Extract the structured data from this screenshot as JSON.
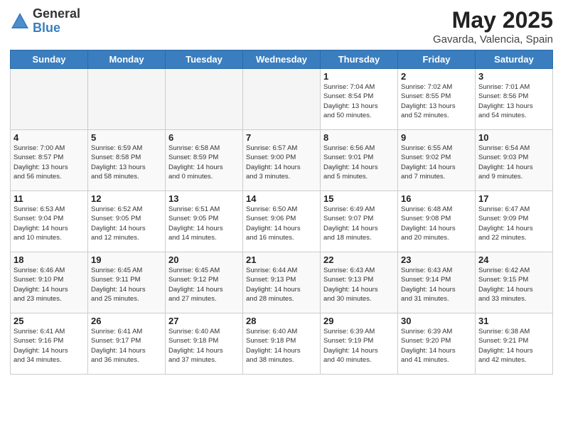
{
  "logo": {
    "general": "General",
    "blue": "Blue"
  },
  "header": {
    "title": "May 2025",
    "subtitle": "Gavarda, Valencia, Spain"
  },
  "weekdays": [
    "Sunday",
    "Monday",
    "Tuesday",
    "Wednesday",
    "Thursday",
    "Friday",
    "Saturday"
  ],
  "weeks": [
    [
      {
        "day": "",
        "info": ""
      },
      {
        "day": "",
        "info": ""
      },
      {
        "day": "",
        "info": ""
      },
      {
        "day": "",
        "info": ""
      },
      {
        "day": "1",
        "info": "Sunrise: 7:04 AM\nSunset: 8:54 PM\nDaylight: 13 hours\nand 50 minutes."
      },
      {
        "day": "2",
        "info": "Sunrise: 7:02 AM\nSunset: 8:55 PM\nDaylight: 13 hours\nand 52 minutes."
      },
      {
        "day": "3",
        "info": "Sunrise: 7:01 AM\nSunset: 8:56 PM\nDaylight: 13 hours\nand 54 minutes."
      }
    ],
    [
      {
        "day": "4",
        "info": "Sunrise: 7:00 AM\nSunset: 8:57 PM\nDaylight: 13 hours\nand 56 minutes."
      },
      {
        "day": "5",
        "info": "Sunrise: 6:59 AM\nSunset: 8:58 PM\nDaylight: 13 hours\nand 58 minutes."
      },
      {
        "day": "6",
        "info": "Sunrise: 6:58 AM\nSunset: 8:59 PM\nDaylight: 14 hours\nand 0 minutes."
      },
      {
        "day": "7",
        "info": "Sunrise: 6:57 AM\nSunset: 9:00 PM\nDaylight: 14 hours\nand 3 minutes."
      },
      {
        "day": "8",
        "info": "Sunrise: 6:56 AM\nSunset: 9:01 PM\nDaylight: 14 hours\nand 5 minutes."
      },
      {
        "day": "9",
        "info": "Sunrise: 6:55 AM\nSunset: 9:02 PM\nDaylight: 14 hours\nand 7 minutes."
      },
      {
        "day": "10",
        "info": "Sunrise: 6:54 AM\nSunset: 9:03 PM\nDaylight: 14 hours\nand 9 minutes."
      }
    ],
    [
      {
        "day": "11",
        "info": "Sunrise: 6:53 AM\nSunset: 9:04 PM\nDaylight: 14 hours\nand 10 minutes."
      },
      {
        "day": "12",
        "info": "Sunrise: 6:52 AM\nSunset: 9:05 PM\nDaylight: 14 hours\nand 12 minutes."
      },
      {
        "day": "13",
        "info": "Sunrise: 6:51 AM\nSunset: 9:05 PM\nDaylight: 14 hours\nand 14 minutes."
      },
      {
        "day": "14",
        "info": "Sunrise: 6:50 AM\nSunset: 9:06 PM\nDaylight: 14 hours\nand 16 minutes."
      },
      {
        "day": "15",
        "info": "Sunrise: 6:49 AM\nSunset: 9:07 PM\nDaylight: 14 hours\nand 18 minutes."
      },
      {
        "day": "16",
        "info": "Sunrise: 6:48 AM\nSunset: 9:08 PM\nDaylight: 14 hours\nand 20 minutes."
      },
      {
        "day": "17",
        "info": "Sunrise: 6:47 AM\nSunset: 9:09 PM\nDaylight: 14 hours\nand 22 minutes."
      }
    ],
    [
      {
        "day": "18",
        "info": "Sunrise: 6:46 AM\nSunset: 9:10 PM\nDaylight: 14 hours\nand 23 minutes."
      },
      {
        "day": "19",
        "info": "Sunrise: 6:45 AM\nSunset: 9:11 PM\nDaylight: 14 hours\nand 25 minutes."
      },
      {
        "day": "20",
        "info": "Sunrise: 6:45 AM\nSunset: 9:12 PM\nDaylight: 14 hours\nand 27 minutes."
      },
      {
        "day": "21",
        "info": "Sunrise: 6:44 AM\nSunset: 9:13 PM\nDaylight: 14 hours\nand 28 minutes."
      },
      {
        "day": "22",
        "info": "Sunrise: 6:43 AM\nSunset: 9:13 PM\nDaylight: 14 hours\nand 30 minutes."
      },
      {
        "day": "23",
        "info": "Sunrise: 6:43 AM\nSunset: 9:14 PM\nDaylight: 14 hours\nand 31 minutes."
      },
      {
        "day": "24",
        "info": "Sunrise: 6:42 AM\nSunset: 9:15 PM\nDaylight: 14 hours\nand 33 minutes."
      }
    ],
    [
      {
        "day": "25",
        "info": "Sunrise: 6:41 AM\nSunset: 9:16 PM\nDaylight: 14 hours\nand 34 minutes."
      },
      {
        "day": "26",
        "info": "Sunrise: 6:41 AM\nSunset: 9:17 PM\nDaylight: 14 hours\nand 36 minutes."
      },
      {
        "day": "27",
        "info": "Sunrise: 6:40 AM\nSunset: 9:18 PM\nDaylight: 14 hours\nand 37 minutes."
      },
      {
        "day": "28",
        "info": "Sunrise: 6:40 AM\nSunset: 9:18 PM\nDaylight: 14 hours\nand 38 minutes."
      },
      {
        "day": "29",
        "info": "Sunrise: 6:39 AM\nSunset: 9:19 PM\nDaylight: 14 hours\nand 40 minutes."
      },
      {
        "day": "30",
        "info": "Sunrise: 6:39 AM\nSunset: 9:20 PM\nDaylight: 14 hours\nand 41 minutes."
      },
      {
        "day": "31",
        "info": "Sunrise: 6:38 AM\nSunset: 9:21 PM\nDaylight: 14 hours\nand 42 minutes."
      }
    ]
  ]
}
